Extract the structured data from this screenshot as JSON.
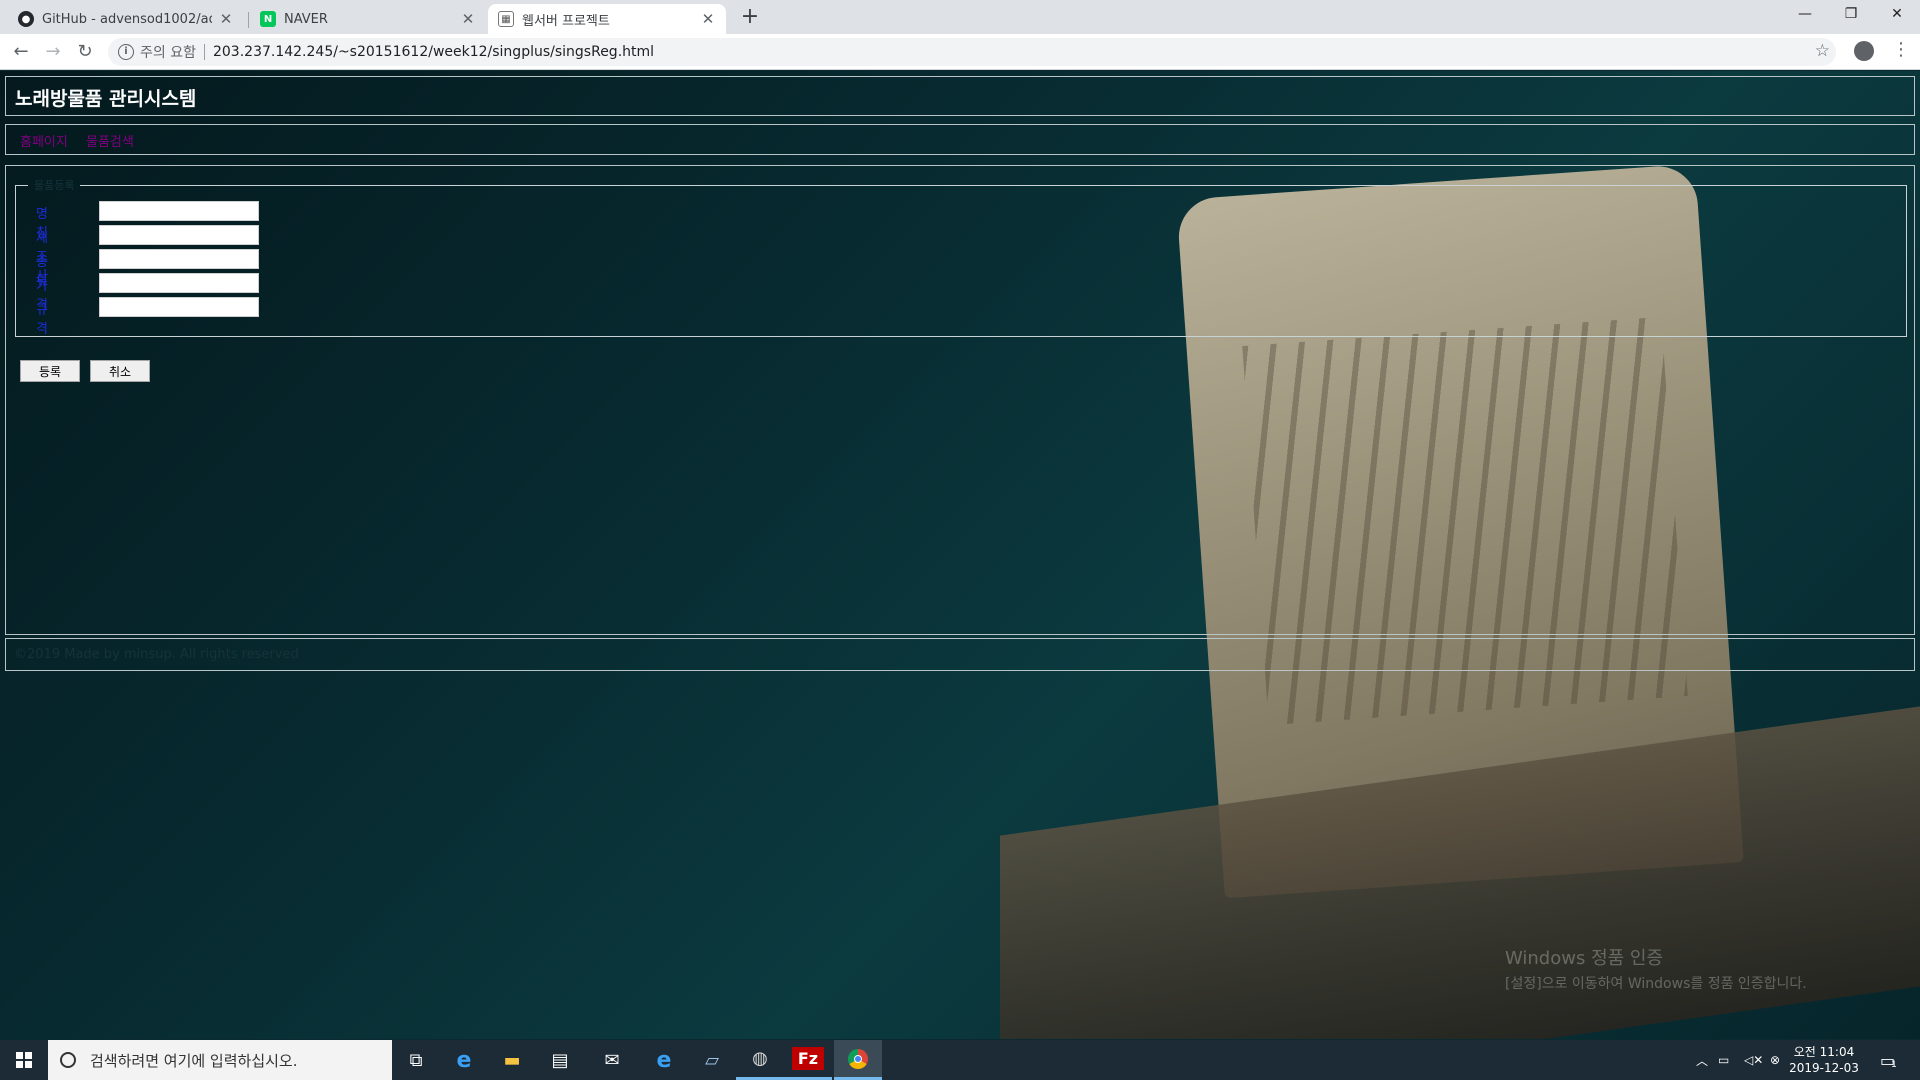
{
  "browser": {
    "tabs": [
      {
        "title": "GitHub - advensod1002/advens",
        "favicon": "github-icon"
      },
      {
        "title": "NAVER",
        "favicon": "naver-icon"
      },
      {
        "title": "웹서버 프로젝트",
        "favicon": "page-icon"
      }
    ],
    "active_tab_index": 2,
    "security_label": "주의 요함",
    "url": "203.237.142.245/~s20151612/week12/singplus/singsReg.html"
  },
  "page": {
    "header_title": "노래방물품 관리시스템",
    "nav": {
      "home": "홈페이지",
      "search": "물품검색"
    },
    "form": {
      "legend": "물품등록",
      "fields": [
        {
          "label": "명칭",
          "value": ""
        },
        {
          "label": "제조사",
          "value": ""
        },
        {
          "label": "종류",
          "value": ""
        },
        {
          "label": "가격",
          "value": ""
        },
        {
          "label": "규격",
          "value": ""
        }
      ],
      "submit_label": "등록",
      "cancel_label": "취소"
    },
    "footer": "©2019 Made by minsup. All rights reserved",
    "watermark_title": "Windows 정품 인증",
    "watermark_sub": "[설정]으로 이동하여 Windows를 정품 인증합니다."
  },
  "taskbar": {
    "search_placeholder": "검색하려면 여기에 입력하십시오.",
    "time": "오전 11:04",
    "date": "2019-12-03",
    "notification_count": "1"
  },
  "colors": {
    "header_text": "#ffffff",
    "nav_link": "#800080",
    "form_label": "#1c2cd8",
    "taskbar": "#1c2b36"
  }
}
